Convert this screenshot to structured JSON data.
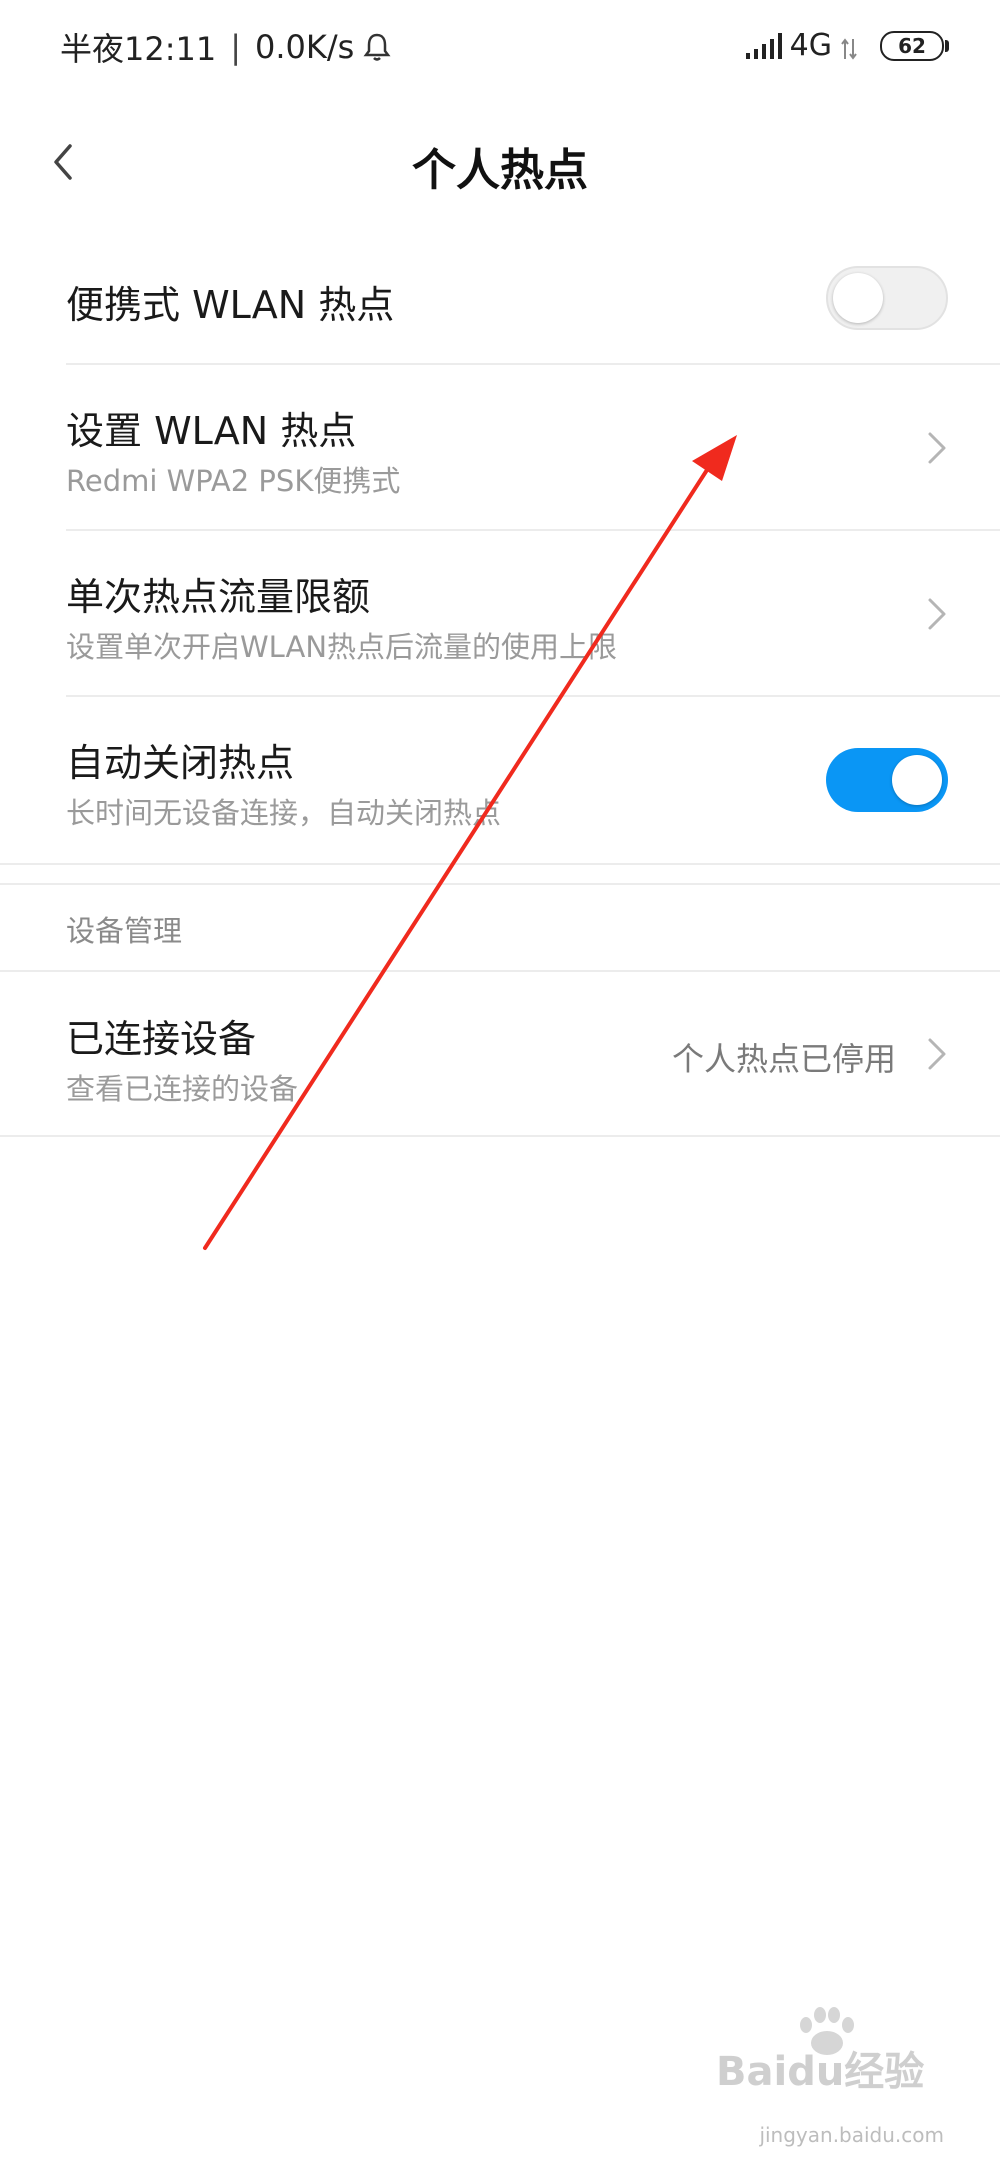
{
  "status_bar": {
    "time": "半夜12:11",
    "separator": "|",
    "net_speed": "0.0K/s",
    "network": "4G",
    "battery": "62",
    "icons": [
      "bell-icon",
      "signal-icon",
      "data-arrows-icon",
      "battery-icon"
    ]
  },
  "header": {
    "title": "个人热点",
    "back_icon": "chevron-left-icon"
  },
  "settings": {
    "portable_hotspot": {
      "title": "便携式 WLAN 热点",
      "enabled": false
    },
    "setup_hotspot": {
      "title": "设置 WLAN 热点",
      "subtitle": "Redmi WPA2 PSK便携式"
    },
    "data_limit": {
      "title": "单次热点流量限额",
      "subtitle": "设置单次开启WLAN热点后流量的使用上限"
    },
    "auto_off": {
      "title": "自动关闭热点",
      "subtitle": "长时间无设备连接，自动关闭热点",
      "enabled": true
    }
  },
  "device_management": {
    "section_label": "设备管理",
    "connected_devices": {
      "title": "已连接设备",
      "subtitle": "查看已连接的设备",
      "value": "个人热点已停用"
    }
  },
  "colors": {
    "accent": "#0a96f5",
    "annotation_arrow": "#f02a1e",
    "subtext": "#9a9a9a"
  },
  "watermark": {
    "brand": "Baidu经验",
    "url": "jingyan.baidu.com"
  }
}
